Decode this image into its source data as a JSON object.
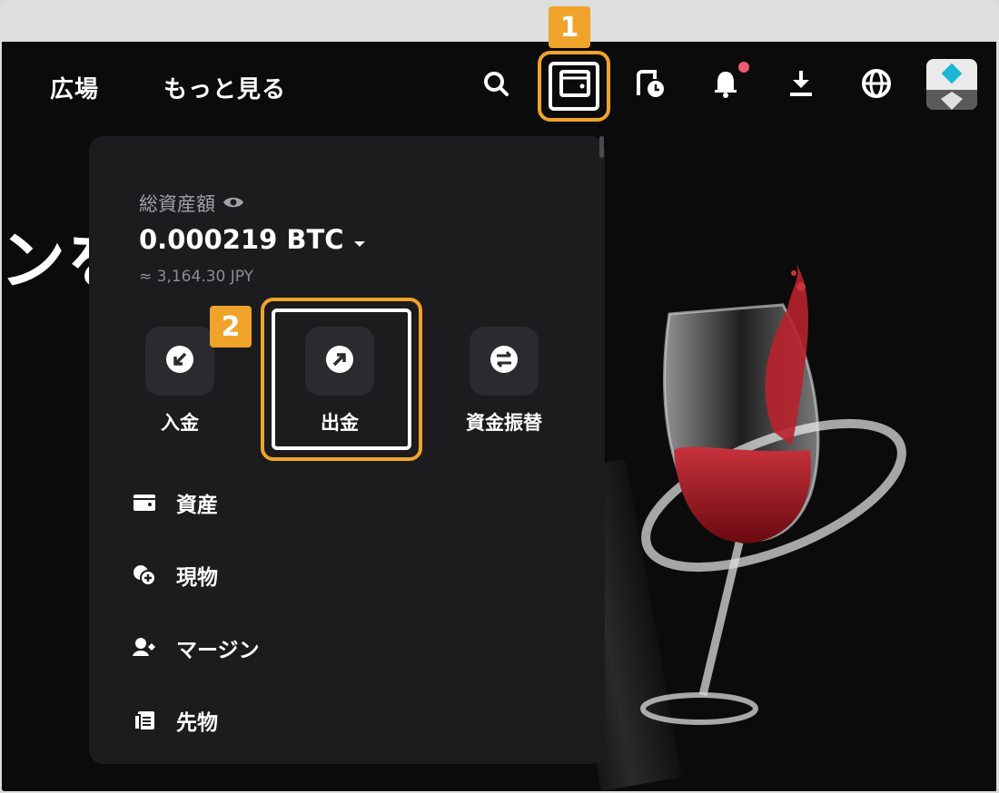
{
  "nav": {
    "links": [
      "広場",
      "もっと見る"
    ],
    "icons": [
      "search-icon",
      "wallet-icon",
      "order-history-icon",
      "notification-bell-icon",
      "download-icon",
      "language-globe-icon"
    ],
    "notification_dot_color": "#f05a6e"
  },
  "hero": {
    "text": "ンを"
  },
  "wallet_panel": {
    "total_label": "総資産額",
    "total_value": "0.000219 BTC",
    "total_jpy": "≈ 3,164.30 JPY",
    "actions": [
      {
        "label": "入金",
        "icon": "deposit-arrow-icon"
      },
      {
        "label": "出金",
        "icon": "withdraw-arrow-icon"
      },
      {
        "label": "資金振替",
        "icon": "transfer-icon"
      }
    ],
    "menu": [
      {
        "label": "資産",
        "icon": "wallet-icon"
      },
      {
        "label": "現物",
        "icon": "spot-coins-icon"
      },
      {
        "label": "マージン",
        "icon": "margin-icon"
      },
      {
        "label": "先物",
        "icon": "futures-icon"
      }
    ]
  },
  "callouts": [
    "1",
    "2"
  ],
  "colors": {
    "accent": "#f0a32b",
    "panel": "#1c1c1f",
    "background": "#0b0b0c"
  }
}
